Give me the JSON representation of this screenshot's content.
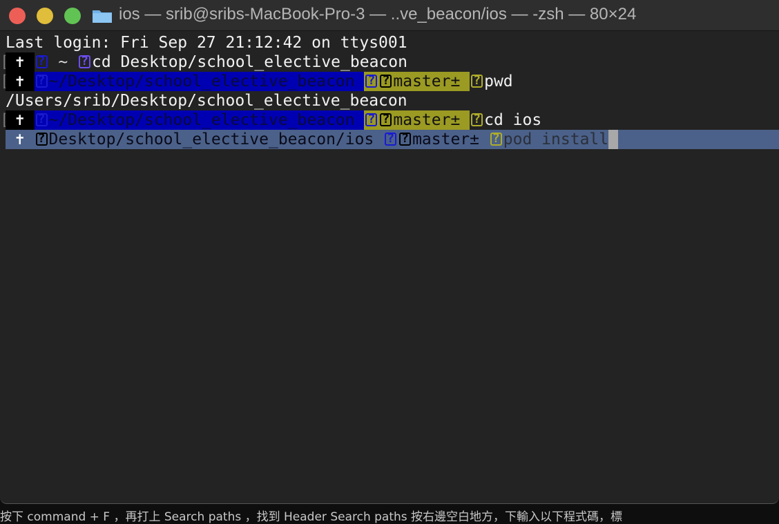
{
  "window": {
    "title": "ios — srib@sribs-MacBook-Pro-3 — ..ve_beacon/ios — -zsh — 80×24"
  },
  "terminal": {
    "last_login": "Last login: Fri Sep 27 21:12:42 on ttys001",
    "bracket": "[",
    "cross": " ✝ ",
    "q": "?",
    "rows": [
      {
        "path": " ~ ",
        "command": "cd Desktop/school_elective_beacon"
      },
      {
        "path": "~/Desktop/school_elective_beacon ",
        "branch": "master± ",
        "command": "pwd"
      },
      {
        "output": "/Users/srib/Desktop/school_elective_beacon"
      },
      {
        "path": "~/Desktop/school_elective_beacon ",
        "branch": "master± ",
        "command": "cd ios"
      },
      {
        "path": "Desktop/school_elective_beacon/ios ",
        "branch": "master± ",
        "command": "pod install"
      }
    ]
  },
  "background_text": "按下 command + F ，再打上 Search paths ，找到 Header Search paths 按右邊空白地方，下輸入以下程式碼，標"
}
